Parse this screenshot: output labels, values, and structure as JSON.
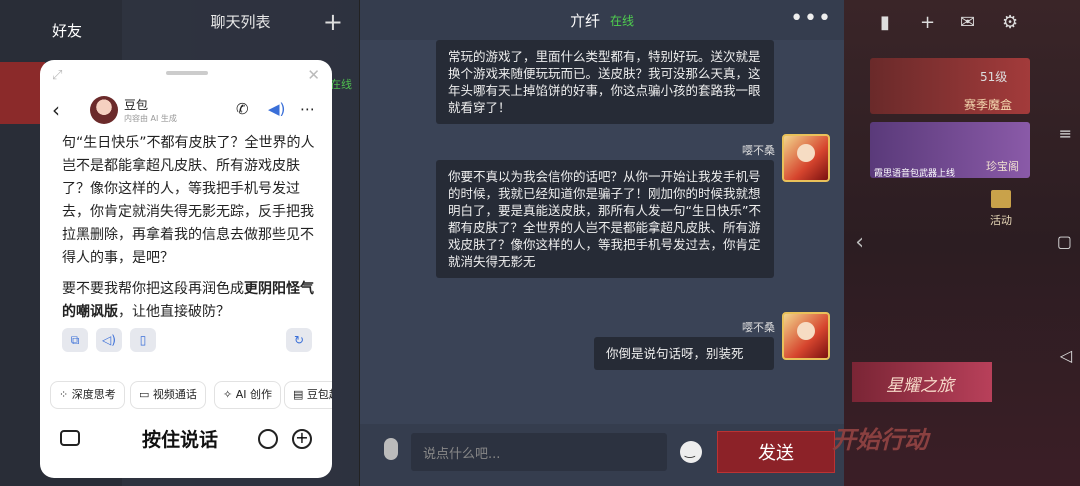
{
  "game": {
    "friends_label": "好友",
    "chatlist_title": "聊天列表",
    "chatlist_online": "在线",
    "right": {
      "level": "51级",
      "season_box": "赛季魔盒",
      "voice_event": "霞思语音包武器上线",
      "treasure": "珍宝阁",
      "activity": "活动",
      "star_journey": "星耀之旅",
      "start_action": "开始行动"
    }
  },
  "chat": {
    "peer_name": "亣纤",
    "peer_status": "在线",
    "messages": [
      {
        "text": "常玩的游戏了，里面什么类型都有，特别好玩。送次就是换个游戏来随便玩玩而已。送皮肤？我可没那么天真，这年头哪有天上掉馅饼的好事，你这点骗小孩的套路我一眼就看穿了！"
      },
      {
        "sender": "嘤不桑",
        "text": "你要不真以为我会信你的话吧？从你一开始让我发手机号的时候，我就已经知道你是骗子了！刚加你的时候我就想明白了，要是真能送皮肤，那所有人发一句“生日快乐”不都有皮肤了？全世界的人岂不是都能拿超凡皮肤、所有游戏皮肤了？像你这样的人，等我把手机号发过去，你肯定就消失得无影无"
      },
      {
        "sender": "嘤不桑",
        "text": "你倒是说句话呀，别装死"
      }
    ],
    "input_placeholder": "说点什么吧...",
    "send_label": "发送"
  },
  "assistant": {
    "bot_name": "豆包",
    "bot_subtitle": "内容由 AI 生成",
    "reply_p1": "句“生日快乐”不都有皮肤了？全世界的人岂不是都能拿超凡皮肤、所有游戏皮肤了？像你这样的人，等我把手机号发过去，你肯定就消失得无影无踪，反手把我拉黑删除，再拿着我的信息去做那些见不得人的事，是吧？",
    "reply_p2_pre": "要不要我帮你把这段再润色成",
    "reply_p2_bold": "更阴阳怪气的嘲讽版",
    "reply_p2_post": "，让他直接破防？",
    "chips": [
      "深度思考",
      "视频通话",
      "AI 创作",
      "豆包超"
    ],
    "hold_to_talk": "按住说话"
  }
}
